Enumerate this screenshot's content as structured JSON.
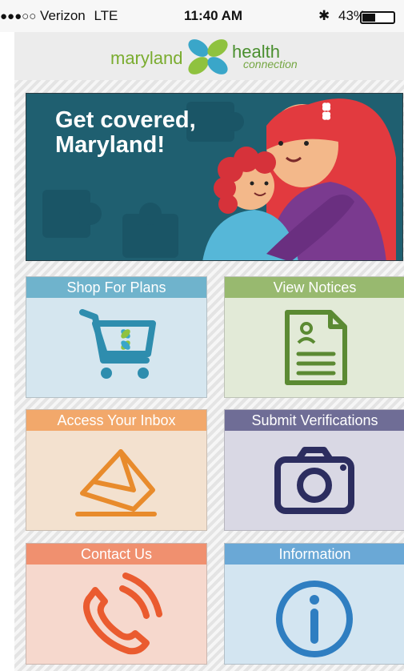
{
  "status_bar": {
    "carrier": "Verizon",
    "network": "LTE",
    "time": "11:40 AM",
    "battery": "43%",
    "battery_level": 0.43
  },
  "logo": {
    "word1": "maryland",
    "word2": "health",
    "word3": "connection"
  },
  "banner": {
    "title": "Get covered, Maryland!"
  },
  "tiles": [
    {
      "label": "Shop For Plans",
      "icon": "shopping-cart-icon",
      "header_color": "#6fb3cc",
      "body_color": "#d5e6ef",
      "icon_color": "#2e8dae"
    },
    {
      "label": "View Notices",
      "icon": "document-icon",
      "header_color": "#98b96f",
      "body_color": "#e2ead7",
      "icon_color": "#5b8a33"
    },
    {
      "label": "Access Your Inbox",
      "icon": "envelope-icon",
      "header_color": "#f2a86b",
      "body_color": "#f3e1cf",
      "icon_color": "#e88b2c"
    },
    {
      "label": "Submit Verifications",
      "icon": "camera-icon",
      "header_color": "#6f6d96",
      "body_color": "#d9d8e4",
      "icon_color": "#2c2d5f"
    },
    {
      "label": "Contact Us",
      "icon": "phone-icon",
      "header_color": "#f0906f",
      "body_color": "#f6d8cd",
      "icon_color": "#ea5b2f"
    },
    {
      "label": "Information",
      "icon": "info-icon",
      "header_color": "#6aa8d6",
      "body_color": "#d3e5f1",
      "icon_color": "#2f7ec1"
    }
  ]
}
